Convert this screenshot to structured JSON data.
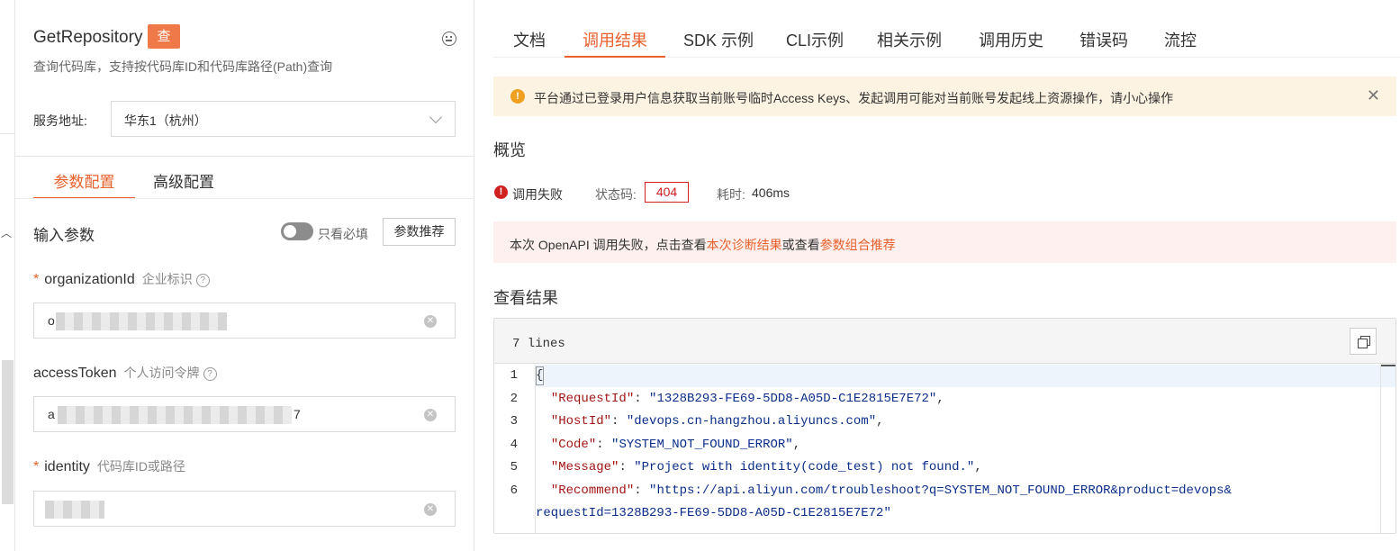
{
  "left_panel": {
    "api_title": "GetRepository",
    "api_badge": "查",
    "api_desc": "查询代码库，支持按代码库ID和代码库路径(Path)查询",
    "service_label": "服务地址:",
    "service_value": "华东1（杭州）",
    "tabs": [
      {
        "label": "参数配置",
        "active": true
      },
      {
        "label": "高级配置",
        "active": false
      }
    ],
    "section_title": "输入参数",
    "toggle_label": "只看必填",
    "toggle_on": false,
    "recommend_button": "参数推荐",
    "fields": [
      {
        "name": "organizationId",
        "desc": "企业标识",
        "required": true,
        "value_visible": "o",
        "masked": true
      },
      {
        "name": "accessToken",
        "desc": "个人访问令牌",
        "required": false,
        "value_visible_prefix": "a",
        "value_visible_suffix": "7",
        "masked": true
      },
      {
        "name": "identity",
        "desc": "代码库ID或路径",
        "required": true,
        "masked": true
      }
    ]
  },
  "right_panel": {
    "tabs": [
      {
        "label": "文档",
        "active": false
      },
      {
        "label": "调用结果",
        "active": true
      },
      {
        "label": "SDK 示例",
        "active": false
      },
      {
        "label": "CLI示例",
        "active": false
      },
      {
        "label": "相关示例",
        "active": false
      },
      {
        "label": "调用历史",
        "active": false
      },
      {
        "label": "错误码",
        "active": false
      },
      {
        "label": "流控",
        "active": false
      }
    ],
    "warning_text": "平台通过已登录用户信息获取当前账号临时Access Keys、发起调用可能对当前账号发起线上资源操作，请小心操作",
    "overview_title": "概览",
    "status": {
      "result": "调用失败",
      "code_label": "状态码:",
      "code": "404",
      "time_label": "耗时:",
      "time": "406ms"
    },
    "diagnosis": {
      "prefix": "本次 OpenAPI 调用失败，点击查看",
      "link1": "本次诊断结果",
      "middle": "或查看",
      "link2": "参数组合推荐"
    },
    "result_title": "查看结果",
    "code_panel": {
      "lines_label": "7 lines",
      "line_numbers": [
        "1",
        "2",
        "3",
        "4",
        "5",
        "6"
      ],
      "json": {
        "RequestId": "1328B293-FE69-5DD8-A05D-C1E2815E7E72",
        "HostId": "devops.cn-hangzhou.aliyuncs.com",
        "Code": "SYSTEM_NOT_FOUND_ERROR",
        "Message": "Project with identity(code_test) not found.",
        "Recommend_part1": "https://api.aliyun.com/troubleshoot?q=SYSTEM_NOT_FOUND_ERROR&product=devops&",
        "Recommend_part2": "requestId=1328B293-FE69-5DD8-A05D-C1E2815E7E72"
      }
    }
  },
  "colors": {
    "accent": "#e8602c",
    "error": "#d02020",
    "warning_bg": "#fdf3e2",
    "diag_bg": "#fdf0ee"
  }
}
